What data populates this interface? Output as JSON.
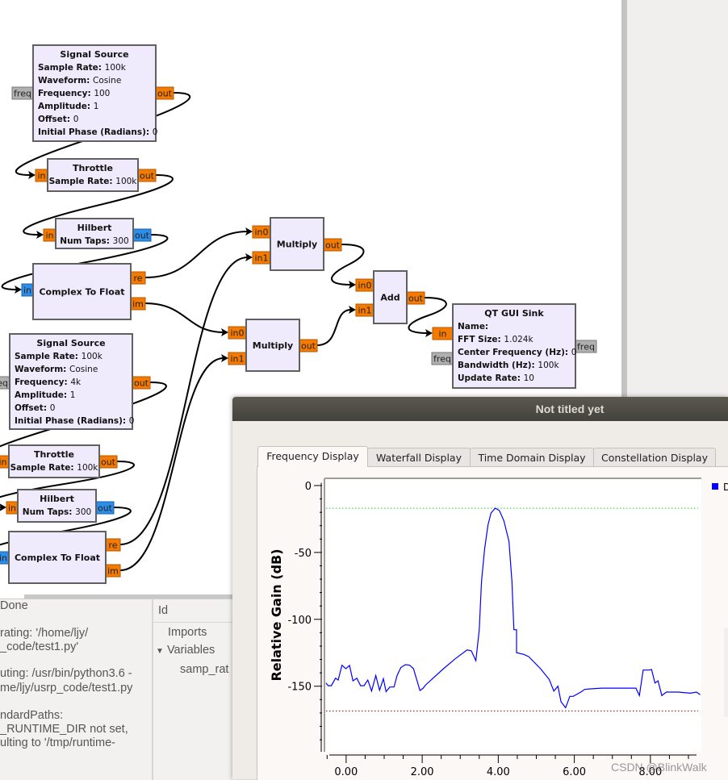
{
  "flowgraph": {
    "blocks": [
      {
        "title": "Signal Source",
        "params": [
          [
            "Sample Rate",
            "100k"
          ],
          [
            "Waveform",
            "Cosine"
          ],
          [
            "Frequency",
            "100"
          ],
          [
            "Amplitude",
            "1"
          ],
          [
            "Offset",
            "0"
          ],
          [
            "Initial Phase (Radians)",
            "0"
          ]
        ],
        "ports": [
          {
            "label": "freq",
            "kind": "message"
          },
          {
            "label": "out",
            "kind": "float"
          }
        ]
      },
      {
        "title": "Throttle",
        "params": [
          [
            "Sample Rate",
            "100k"
          ]
        ],
        "ports": [
          {
            "label": "in",
            "kind": "float"
          },
          {
            "label": "out",
            "kind": "float"
          }
        ]
      },
      {
        "title": "Hilbert",
        "params": [
          [
            "Num Taps",
            "300"
          ]
        ],
        "ports": [
          {
            "label": "in",
            "kind": "float"
          },
          {
            "label": "out",
            "kind": "complex"
          }
        ]
      },
      {
        "title": "Complex To Float",
        "params": [],
        "ports": [
          {
            "label": "in",
            "kind": "complex"
          },
          {
            "label": "re",
            "kind": "float"
          },
          {
            "label": "im",
            "kind": "float"
          }
        ]
      },
      {
        "title": "Multiply",
        "params": [],
        "ports": [
          {
            "label": "in0",
            "kind": "float"
          },
          {
            "label": "in1",
            "kind": "float"
          },
          {
            "label": "out",
            "kind": "float"
          }
        ]
      },
      {
        "title": "Multiply",
        "params": [],
        "ports": [
          {
            "label": "in0",
            "kind": "float"
          },
          {
            "label": "in1",
            "kind": "float"
          },
          {
            "label": "out",
            "kind": "float"
          }
        ]
      },
      {
        "title": "Add",
        "params": [],
        "ports": [
          {
            "label": "in0",
            "kind": "float"
          },
          {
            "label": "in1",
            "kind": "float"
          },
          {
            "label": "out",
            "kind": "float"
          }
        ]
      },
      {
        "title": "QT GUI Sink",
        "params": [
          [
            "Name",
            ""
          ],
          [
            "FFT Size",
            "1.024k"
          ],
          [
            "Center Frequency (Hz)",
            "0"
          ],
          [
            "Bandwidth (Hz)",
            "100k"
          ],
          [
            "Update Rate",
            "10"
          ]
        ],
        "ports": [
          {
            "label": "in",
            "kind": "float"
          },
          {
            "label": "freq",
            "kind": "message"
          },
          {
            "label": "freq",
            "kind": "message"
          }
        ]
      },
      {
        "title": "Signal Source",
        "params": [
          [
            "Sample Rate",
            "100k"
          ],
          [
            "Waveform",
            "Cosine"
          ],
          [
            "Frequency",
            "4k"
          ],
          [
            "Amplitude",
            "1"
          ],
          [
            "Offset",
            "0"
          ],
          [
            "Initial Phase (Radians)",
            "0"
          ]
        ],
        "ports": [
          {
            "label": "freq",
            "kind": "message"
          },
          {
            "label": "out",
            "kind": "float"
          }
        ]
      },
      {
        "title": "Throttle",
        "params": [
          [
            "Sample Rate",
            "100k"
          ]
        ],
        "ports": [
          {
            "label": "in",
            "kind": "float"
          },
          {
            "label": "out",
            "kind": "float"
          }
        ]
      },
      {
        "title": "Hilbert",
        "params": [
          [
            "Num Taps",
            "300"
          ]
        ],
        "ports": [
          {
            "label": "in",
            "kind": "float"
          },
          {
            "label": "out",
            "kind": "complex"
          }
        ]
      },
      {
        "title": "Complex To Float",
        "params": [],
        "ports": [
          {
            "label": "in",
            "kind": "complex"
          },
          {
            "label": "re",
            "kind": "float"
          },
          {
            "label": "im",
            "kind": "float"
          }
        ]
      }
    ],
    "port_colors": {
      "float": "#f47a00",
      "complex": "#2c8ee8",
      "message": "#b0b0b0"
    },
    "block_fill": "#efeafc"
  },
  "console": {
    "lines": [
      "Done",
      "rating: '/home/ljy/",
      "_code/test1.py'",
      "uting: /usr/bin/python3.6 -",
      "me/ljy/usrp_code/test1.py",
      "ndardPaths:",
      "_RUNTIME_DIR not set,",
      "ulting to '/tmp/runtime-"
    ]
  },
  "variables": {
    "header": "Id",
    "imports": "Imports",
    "variables": "Variables",
    "expand_icon": "triangle-down",
    "samp_rate": "samp_rat"
  },
  "dialog": {
    "title": "Not titled yet",
    "tabs": [
      {
        "label": "Frequency Display",
        "active": true
      },
      {
        "label": "Waterfall Display",
        "active": false
      },
      {
        "label": "Time Domain Display",
        "active": false
      },
      {
        "label": "Constellation Display",
        "active": false
      }
    ],
    "legend_label": "D"
  },
  "chart_data": {
    "type": "line",
    "title": "",
    "xlabel": "",
    "ylabel": "Relative Gain (dB)",
    "xlim": [
      -0.57,
      9.34
    ],
    "ylim": [
      -199,
      5.4
    ],
    "x_ticks": [
      "0.00",
      "2.00",
      "4.00",
      "6.00",
      "8.00"
    ],
    "x_tick_values": [
      0,
      2,
      4,
      6,
      8
    ],
    "y_ticks": [
      "0",
      "-50",
      "-100",
      "-150"
    ],
    "y_tick_values": [
      0,
      -50,
      -100,
      -150
    ],
    "grid": false,
    "legend": "right",
    "max_hold": -17,
    "min_hold": -168.5,
    "colors": {
      "trace": "#0000ff",
      "max_hold": "#22cc22",
      "min_hold": "#8b0000"
    },
    "series": [
      {
        "x": [
          -0.53,
          -0.47,
          -0.39,
          -0.28,
          -0.21,
          -0.11,
          -0.01,
          0.09,
          0.18,
          0.28,
          0.38,
          0.47,
          0.57,
          0.67,
          0.78,
          0.88,
          0.98,
          1.05,
          1.15,
          1.26,
          1.34,
          1.44,
          1.56,
          1.67,
          1.77,
          1.94,
          2.02,
          2.09,
          2.56,
          2.87,
          3.18,
          3.29,
          3.41,
          3.5,
          3.56,
          3.64,
          3.73,
          3.81,
          3.92,
          4.03,
          4.15,
          4.28,
          4.36,
          4.41,
          4.48,
          4.48,
          4.68,
          4.8,
          5.11,
          5.34,
          5.46,
          5.57,
          5.65,
          5.77,
          5.88,
          5.97,
          6.19,
          6.27,
          6.42,
          6.73,
          7.12,
          7.62,
          7.71,
          7.81,
          7.97,
          8.03,
          8.12,
          8.2,
          8.3,
          8.42,
          8.74,
          9.05,
          9.21,
          9.31
        ],
        "y": [
          -147.6,
          -149.6,
          -149.6,
          -144.0,
          -145.4,
          -134.3,
          -136.9,
          -134.5,
          -146.0,
          -144.0,
          -149.6,
          -149.6,
          -145.4,
          -153.6,
          -142.0,
          -153.0,
          -144.4,
          -154.0,
          -150.6,
          -150.6,
          -142.0,
          -136.0,
          -133.9,
          -134.3,
          -136.9,
          -153.2,
          -151.6,
          -149.0,
          -136.9,
          -129.5,
          -122.9,
          -123.5,
          -130.9,
          -107.8,
          -71.7,
          -47.6,
          -29.5,
          -20.5,
          -16.9,
          -18.7,
          -26.5,
          -41.6,
          -71.7,
          -107.8,
          -107.8,
          -124.9,
          -126.3,
          -127.9,
          -136.9,
          -145.0,
          -153.6,
          -150.0,
          -161.6,
          -166.1,
          -157.6,
          -157.6,
          -154.0,
          -152.4,
          -152.0,
          -151.4,
          -151.4,
          -151.4,
          -157.0,
          -137.9,
          -137.9,
          -137.5,
          -147.6,
          -146.0,
          -157.0,
          -154.4,
          -154.4,
          -155.2,
          -154.4,
          -156.4
        ]
      }
    ]
  },
  "watermark": "CSDN @BlinkWalk"
}
